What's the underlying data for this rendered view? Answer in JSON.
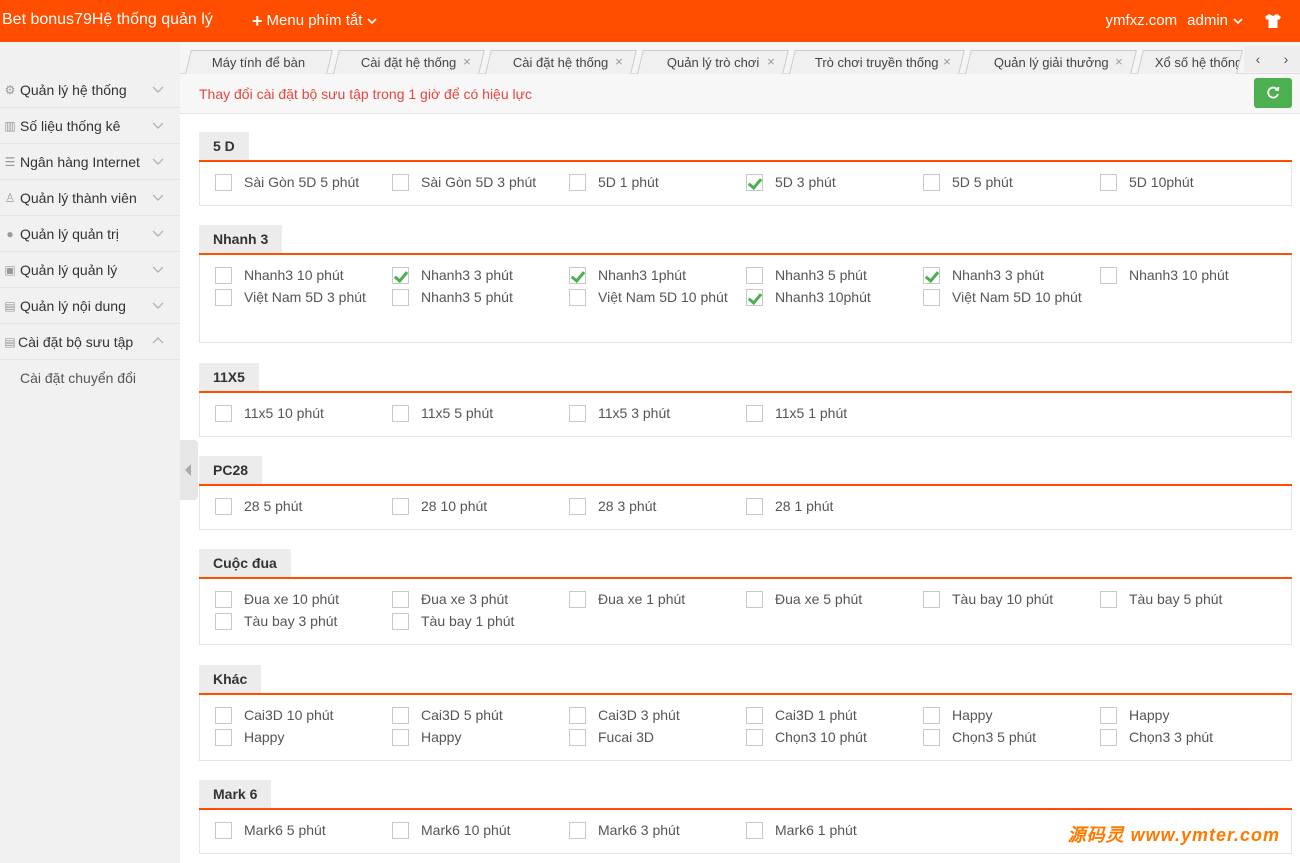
{
  "header": {
    "brand": "Bet bonus79Hệ thống quản lý",
    "quick_menu": "Menu phím tắt",
    "domain": "ymfxz.com",
    "user": "admin"
  },
  "sidebar": {
    "items": [
      {
        "label": "Quản lý hệ thống",
        "icon": "gear-icon"
      },
      {
        "label": "Số liệu thống kê",
        "icon": "chart-icon"
      },
      {
        "label": "Ngân hàng Internet",
        "icon": "list-icon"
      },
      {
        "label": "Quản lý thành viên",
        "icon": "user-icon"
      },
      {
        "label": "Quản lý quản trị",
        "icon": "person-icon"
      },
      {
        "label": "Quản lý quản lý",
        "icon": "gift-icon"
      },
      {
        "label": "Quản lý nội dung",
        "icon": "doc-icon"
      },
      {
        "label": "Cài đặt bộ sưu tập",
        "icon": "doc-icon"
      }
    ],
    "sub_item": "Cài đặt chuyển đổi"
  },
  "tabs": [
    {
      "label": "Máy tính để bàn"
    },
    {
      "label": "Cài đặt hệ thống"
    },
    {
      "label": "Cài đặt hệ thống"
    },
    {
      "label": "Quản lý trò chơi"
    },
    {
      "label": "Trò chơi truyền thống"
    },
    {
      "label": "Quản lý giải thưởng"
    },
    {
      "label": "Xổ số hệ thống"
    }
  ],
  "notice": "Thay đổi cài đặt bộ sưu tập trong 1 giờ để có hiệu lực",
  "sections": [
    {
      "title": "5 D",
      "options": [
        {
          "label": "Sài Gòn 5D 5 phút",
          "checked": false
        },
        {
          "label": "Sài Gòn 5D 3 phút",
          "checked": false
        },
        {
          "label": "5D 1 phút",
          "checked": false
        },
        {
          "label": "5D 3 phút",
          "checked": true
        },
        {
          "label": "5D 5 phút",
          "checked": false
        },
        {
          "label": "5D 10phút",
          "checked": false
        }
      ]
    },
    {
      "title": "Nhanh 3",
      "options": [
        {
          "label": "Nhanh3 10 phút",
          "checked": false
        },
        {
          "label": "Nhanh3 3 phút",
          "checked": true
        },
        {
          "label": "Nhanh3 1phút",
          "checked": true
        },
        {
          "label": "Nhanh3 5 phút",
          "checked": false
        },
        {
          "label": "Nhanh3 3 phút",
          "checked": true
        },
        {
          "label": "Nhanh3 10 phút",
          "checked": false
        },
        {
          "label": "Việt Nam 5D 3 phút",
          "checked": false
        },
        {
          "label": "Nhanh3 5 phút",
          "checked": false
        },
        {
          "label": "Việt Nam 5D 10 phút",
          "checked": false
        },
        {
          "label": "Nhanh3 10phút",
          "checked": true
        },
        {
          "label": "Việt Nam 5D 10 phút",
          "checked": false
        }
      ]
    },
    {
      "title": "11X5",
      "options": [
        {
          "label": "11x5 10 phút",
          "checked": false
        },
        {
          "label": "11x5 5 phút",
          "checked": false
        },
        {
          "label": "11x5 3 phút",
          "checked": false
        },
        {
          "label": "11x5 1 phút",
          "checked": false
        }
      ]
    },
    {
      "title": "PC28",
      "options": [
        {
          "label": "28 5 phút",
          "checked": false
        },
        {
          "label": "28 10 phút",
          "checked": false
        },
        {
          "label": "28 3 phút",
          "checked": false
        },
        {
          "label": "28 1 phút",
          "checked": false
        }
      ]
    },
    {
      "title": "Cuộc đua",
      "options": [
        {
          "label": "Đua xe 10 phút",
          "checked": false
        },
        {
          "label": "Đua xe 3 phút",
          "checked": false
        },
        {
          "label": "Đua xe 1 phút",
          "checked": false
        },
        {
          "label": "Đua xe 5 phút",
          "checked": false
        },
        {
          "label": "Tàu bay 10 phút",
          "checked": false
        },
        {
          "label": "Tàu bay 5 phút",
          "checked": false
        },
        {
          "label": "Tàu bay 3 phút",
          "checked": false
        },
        {
          "label": "Tàu bay 1 phút",
          "checked": false
        }
      ]
    },
    {
      "title": "Khác",
      "options": [
        {
          "label": "Cai3D 10 phút",
          "checked": false
        },
        {
          "label": "Cai3D 5 phút",
          "checked": false
        },
        {
          "label": "Cai3D 3 phút",
          "checked": false
        },
        {
          "label": "Cai3D 1 phút",
          "checked": false
        },
        {
          "label": "Happy",
          "checked": false
        },
        {
          "label": "Happy",
          "checked": false
        },
        {
          "label": "Happy",
          "checked": false
        },
        {
          "label": "Happy",
          "checked": false
        },
        {
          "label": "Fucai 3D",
          "checked": false
        },
        {
          "label": "Chọn3 10 phút",
          "checked": false
        },
        {
          "label": "Chọn3 5 phút",
          "checked": false
        },
        {
          "label": "Chọn3 3 phút",
          "checked": false
        }
      ]
    },
    {
      "title": "Mark 6",
      "options": [
        {
          "label": "Mark6 5 phút",
          "checked": false
        },
        {
          "label": "Mark6 10 phút",
          "checked": false
        },
        {
          "label": "Mark6 3 phút",
          "checked": false
        },
        {
          "label": "Mark6 1 phút",
          "checked": false
        }
      ]
    }
  ],
  "watermark": "源码灵 www.ymter.com",
  "colors": {
    "accent": "#ff4e00",
    "check": "#4caf50",
    "notice": "#e8453c"
  }
}
